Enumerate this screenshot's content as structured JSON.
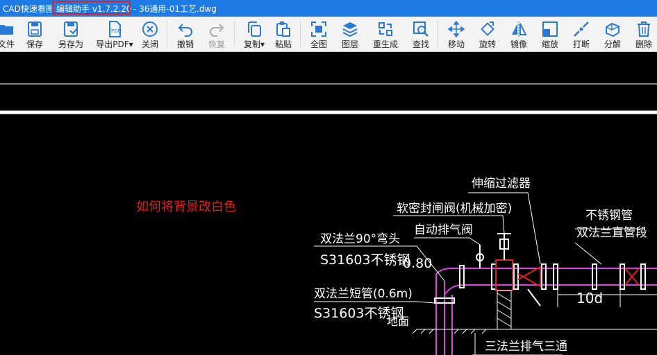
{
  "titlebar": {
    "app": "CAD快速看图",
    "editor": "编辑助手 v1.7.2.20",
    "file": "- 36通用-01工艺.dwg"
  },
  "toolbar": {
    "open": "文件",
    "save": "保存",
    "saveas": "另存为",
    "export_pdf": "导出PDF▾",
    "close": "关闭",
    "undo": "撤销",
    "redo": "恢复",
    "copy": "复制▾",
    "paste": "粘贴",
    "fullview": "全图",
    "layers": "图层",
    "regen": "重生成",
    "find": "查找",
    "move": "移动",
    "rotate": "旋转",
    "mirror": "镜像",
    "scale": "缩放",
    "break": "打断",
    "explode": "分解",
    "delete": "删除"
  },
  "overlay": {
    "question": "如何将背景改白色",
    "color": "#e02020"
  },
  "drawing": {
    "filter": "伸缩过滤器",
    "soft_valve": "软密封闸阀(机械加密)",
    "air_valve": "自动排气阀",
    "ss_pipe": "不锈钢管",
    "flange_pipe": "双法兰直管段",
    "elbow": "双法兰90°弯头",
    "elbow_mat": "S31603不锈钢",
    "elbow_size": "0.80",
    "short_pipe": "双法兰短管(0.6m)",
    "short_mat": "S31603不锈钢",
    "ground": "地面",
    "tee": "三法兰排气三通",
    "dim": "10d"
  }
}
